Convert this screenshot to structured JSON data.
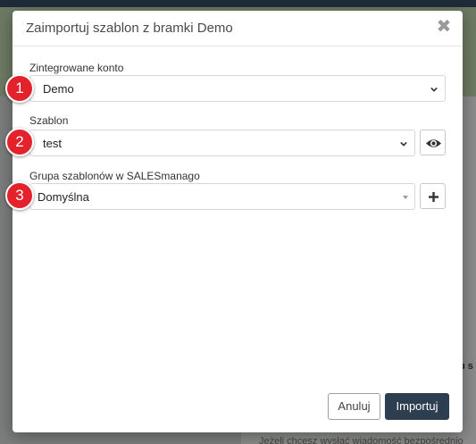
{
  "background": {
    "right_text": "u s",
    "bottom_text": "Jeżeli chcesz wysłać wiadomość bezpośrednio"
  },
  "modal": {
    "title": "Zaimportuj szablon z bramki Demo",
    "close_icon": "close-icon",
    "fields": [
      {
        "label": "Zintegrowane konto",
        "value": "Demo",
        "badge": "1"
      },
      {
        "label": "Szablon",
        "value": "test",
        "badge": "2",
        "action_icon": "eye-icon"
      },
      {
        "label": "Grupa szablonów w SALESmanago",
        "value": "Domyślna",
        "badge": "3",
        "action_icon": "plus-icon"
      }
    ],
    "buttons": {
      "cancel": "Anuluj",
      "import": "Importuj"
    }
  },
  "colors": {
    "badge": "#e3222b",
    "primary_button": "#2c3e50"
  }
}
